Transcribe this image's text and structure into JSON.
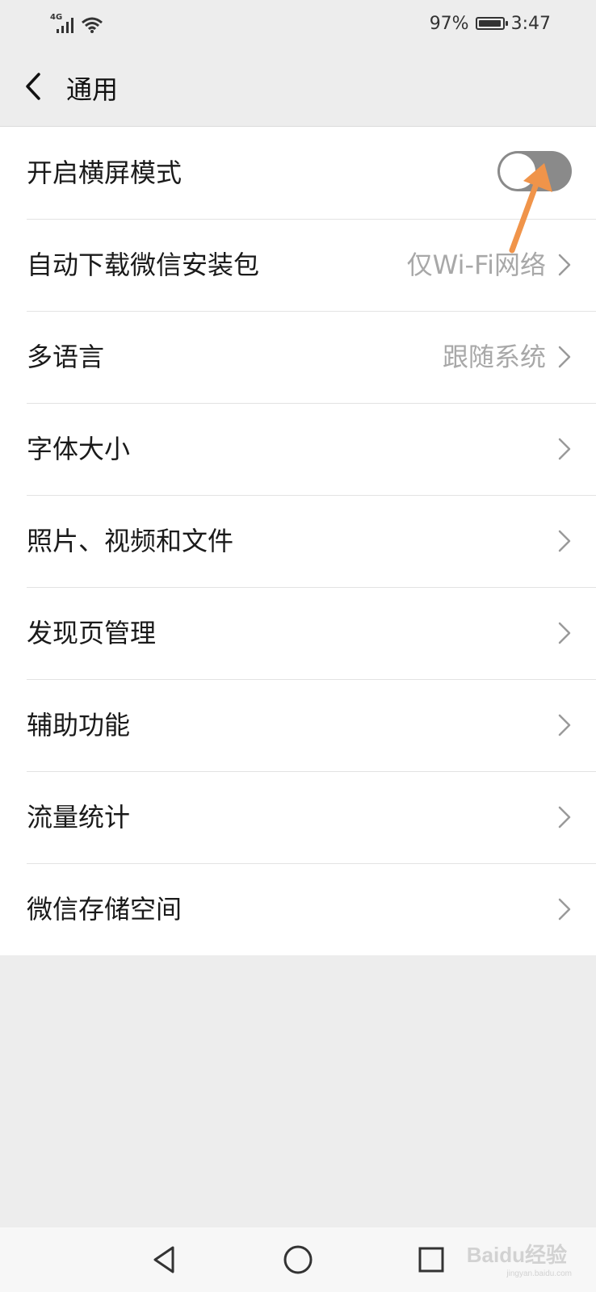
{
  "status_bar": {
    "network": "4G",
    "battery_percent": "97%",
    "battery_level": 0.97,
    "time": "3:47",
    "icons": [
      "cellular-signal-icon",
      "wifi-icon",
      "battery-icon"
    ]
  },
  "header": {
    "back_icon": "back-chevron-icon",
    "title": "通用"
  },
  "settings": {
    "landscape_mode": {
      "label": "开启横屏模式",
      "enabled": false
    },
    "items": [
      {
        "label": "自动下载微信安装包",
        "value": "仅Wi-Fi网络"
      },
      {
        "label": "多语言",
        "value": "跟随系统"
      },
      {
        "label": "字体大小",
        "value": ""
      },
      {
        "label": "照片、视频和文件",
        "value": ""
      },
      {
        "label": "发现页管理",
        "value": ""
      },
      {
        "label": "辅助功能",
        "value": ""
      },
      {
        "label": "流量统计",
        "value": ""
      },
      {
        "label": "微信存储空间",
        "value": ""
      }
    ]
  },
  "system_nav": {
    "buttons": [
      "back-triangle-icon",
      "home-circle-icon",
      "recents-square-icon"
    ]
  },
  "watermark": {
    "text": "Baidu经验",
    "sub": "jingyan.baidu.com"
  },
  "colors": {
    "background": "#ededed",
    "list_background": "#ffffff",
    "toggle_off": "#8a8a8a",
    "annotation_arrow": "#f0944a",
    "secondary_text": "#a8a8a8"
  }
}
